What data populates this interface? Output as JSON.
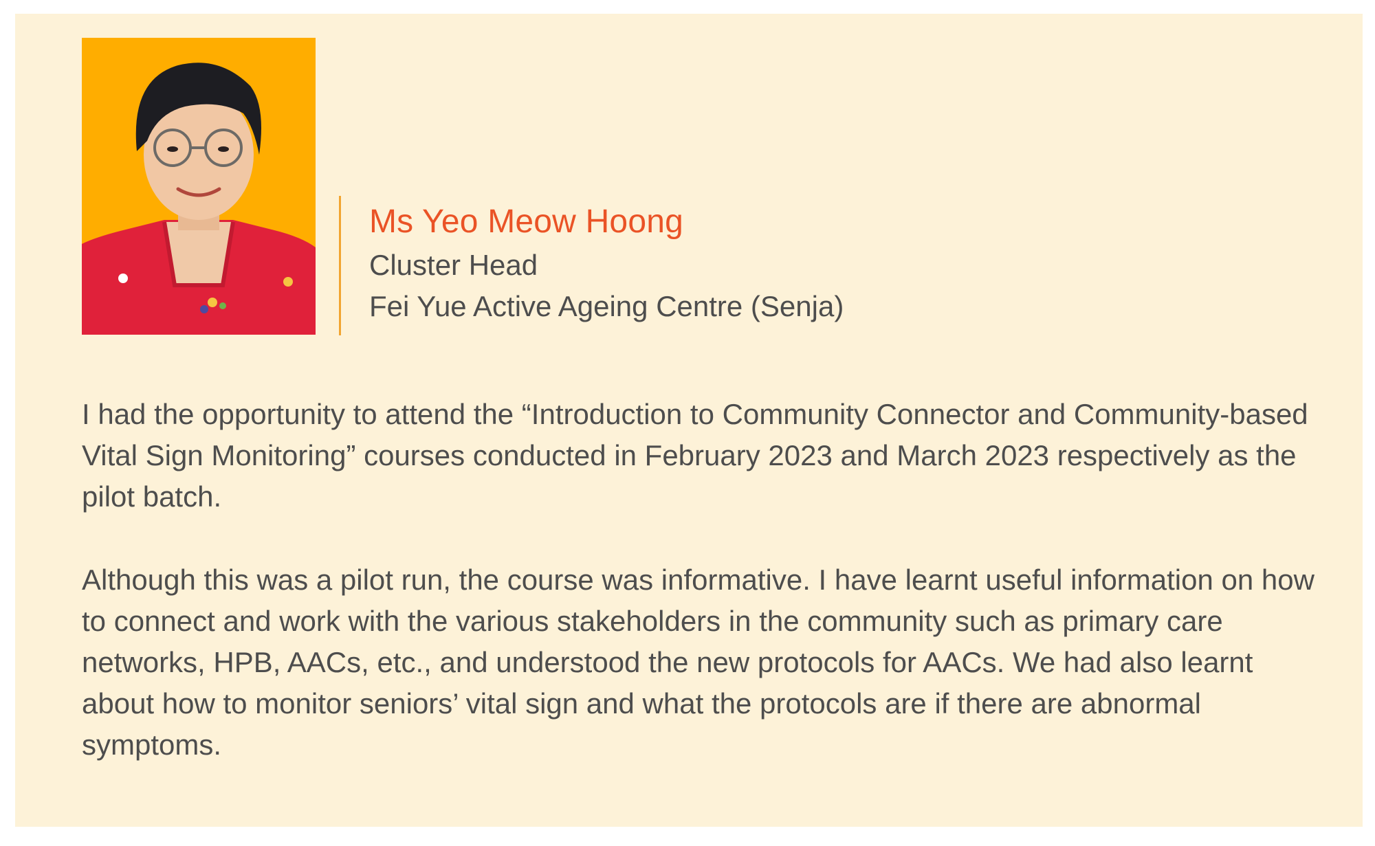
{
  "profile": {
    "photo_alt": "portrait-photo",
    "name": "Ms Yeo Meow Hoong",
    "role": "Cluster Head",
    "organisation": "Fei Yue Active Ageing Centre (Senja)"
  },
  "testimonial": {
    "paragraphs": [
      "I had the opportunity to attend the “Introduction to Community Connector and Community-based Vital Sign Monitoring” courses conducted in February 2023 and March 2023 respectively as the pilot batch.",
      "Although this was a pilot run, the course was informative. I have learnt useful information on how to connect and work with the various stakeholders in the community such as primary care networks, HPB, AACs, etc., and understood the new protocols for AACs. We had also learnt about how to monitor seniors’ vital sign and what the protocols are if there are abnormal symptoms."
    ]
  },
  "colors": {
    "card_background": "#fdf2d8",
    "photo_background": "#ffad00",
    "accent_divider": "#f2a531",
    "name_color": "#ea5326",
    "body_text": "#4d4d4d"
  }
}
